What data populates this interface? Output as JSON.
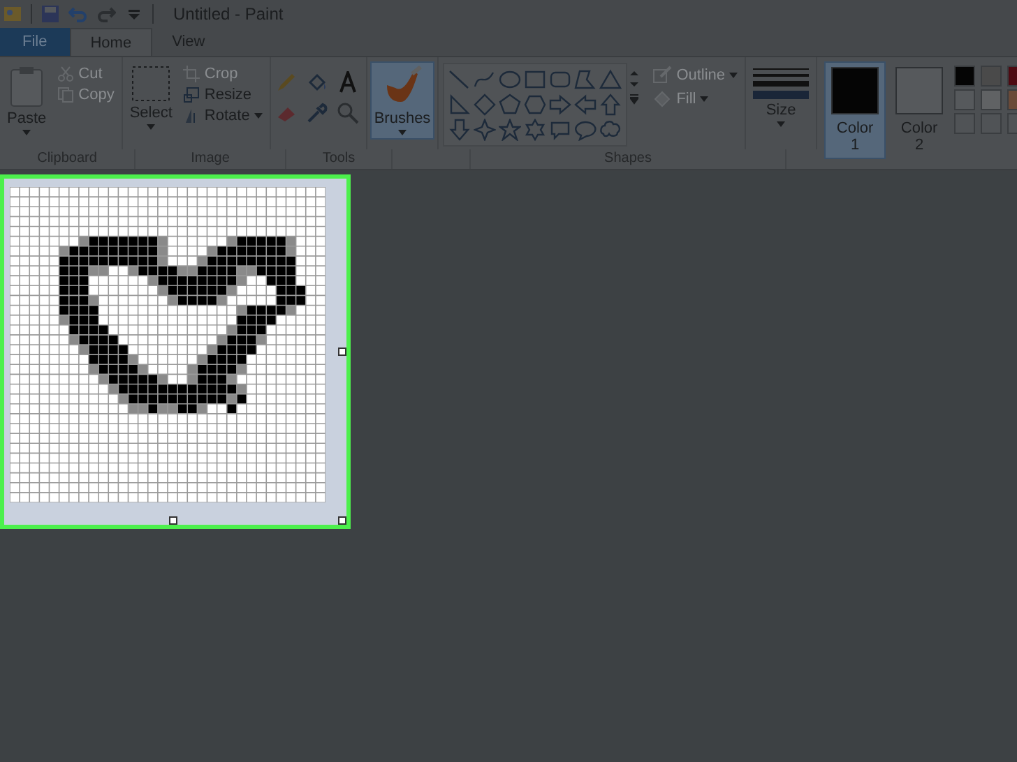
{
  "window": {
    "title": "Untitled - Paint"
  },
  "tabs": [
    {
      "label": "File",
      "kind": "file",
      "selected": false
    },
    {
      "label": "Home",
      "kind": "tab",
      "selected": true
    },
    {
      "label": "View",
      "kind": "tab",
      "selected": false
    }
  ],
  "clipboard": {
    "label": "Clipboard",
    "paste": "Paste",
    "cut": {
      "label": "Cut",
      "disabled": true
    },
    "copy": {
      "label": "Copy",
      "disabled": true
    }
  },
  "image": {
    "label": "Image",
    "select": "Select",
    "crop": {
      "label": "Crop",
      "disabled": true
    },
    "resize": "Resize",
    "rotate": "Rotate"
  },
  "tools": {
    "label": "Tools"
  },
  "brushes": {
    "label": "Brushes",
    "selected": true
  },
  "shapes": {
    "label": "Shapes",
    "outline": {
      "label": "Outline",
      "disabled": true
    },
    "fill": {
      "label": "Fill",
      "disabled": true
    }
  },
  "size": {
    "label": "Size"
  },
  "colors": [
    {
      "label": "Color",
      "number": "1",
      "selected": true,
      "color": "#050505"
    },
    {
      "label": "Color",
      "number": "2",
      "selected": false,
      "color": "#56595c"
    }
  ],
  "palette": [
    {
      "color": "#050505"
    },
    {
      "color": "#4a4a4a"
    },
    {
      "color": "#4e0a12"
    },
    {
      "color": "#56595c"
    },
    {
      "color": "#606264"
    },
    {
      "color": "#6a4a38"
    },
    {
      "color": "#505356"
    },
    {
      "color": "#505356"
    },
    {
      "color": "#505356"
    }
  ]
}
